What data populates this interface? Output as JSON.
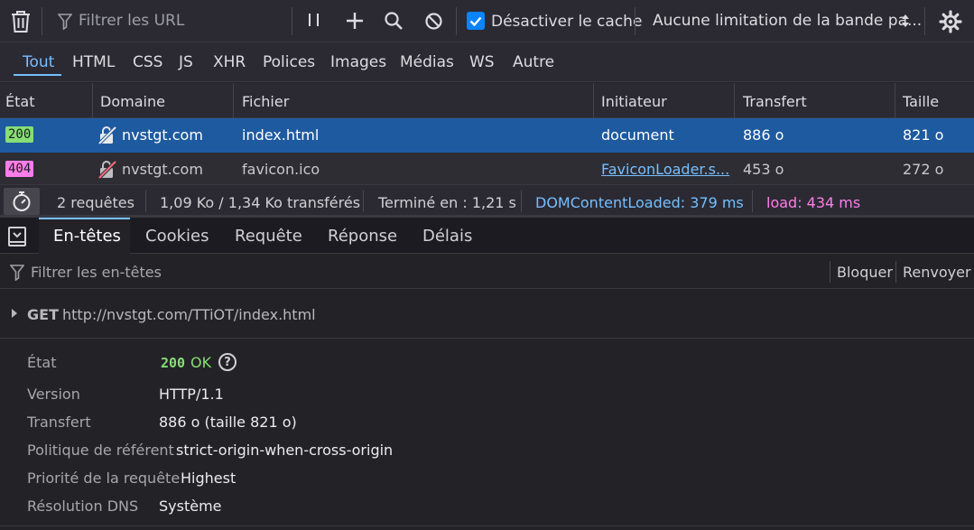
{
  "toolbar": {
    "filter_placeholder": "Filtrer les URL",
    "disable_cache_label": "Désactiver le cache",
    "throttling_value": "Aucune limitation de la bande pa..."
  },
  "filter_tabs": [
    "Tout",
    "HTML",
    "CSS",
    "JS",
    "XHR",
    "Polices",
    "Images",
    "Médias",
    "WS",
    "Autre"
  ],
  "table": {
    "headers": [
      "État",
      "Domaine",
      "Fichier",
      "Initiateur",
      "Transfert",
      "Taille"
    ],
    "rows": [
      {
        "status": "200",
        "domain": "nvstgt.com",
        "file": "index.html",
        "initiator": "document",
        "transfer": "886 o",
        "size": "821 o"
      },
      {
        "status": "404",
        "domain": "nvstgt.com",
        "file": "favicon.ico",
        "initiator": "FaviconLoader.s...",
        "transfer": "453 o",
        "size": "272 o"
      }
    ]
  },
  "summary": {
    "requests": "2 requêtes",
    "transferred": "1,09 Ko / 1,34 Ko transférés",
    "finished": "Terminé en : 1,21 s",
    "domcontentloaded": "DOMContentLoaded: 379 ms",
    "load": "load: 434 ms"
  },
  "detail_tabs": [
    "En-têtes",
    "Cookies",
    "Requête",
    "Réponse",
    "Délais"
  ],
  "headers_panel": {
    "filter_placeholder": "Filtrer les en-têtes",
    "block_label": "Bloquer",
    "resend_label": "Renvoyer",
    "method": "GET",
    "url": "http://nvstgt.com/TTiOT/index.html",
    "status_label": "État",
    "status_code": "200",
    "status_text": "OK",
    "version_label": "Version",
    "version_value": "HTTP/1.1",
    "transfer_label": "Transfert",
    "transfer_value": "886 o (taille 821 o)",
    "referrer_label": "Politique de référent",
    "referrer_value": "strict-origin-when-cross-origin",
    "priority_label": "Priorité de la requête",
    "priority_value": "Highest",
    "dns_label": "Résolution DNS",
    "dns_value": "Système"
  },
  "colors": {
    "accent": "#75bfff",
    "status_200": "#86de74",
    "status_404": "#ff7de9",
    "dcl": "#75bfff",
    "load": "#ff7de9",
    "selected_row": "#1e5aa0"
  }
}
